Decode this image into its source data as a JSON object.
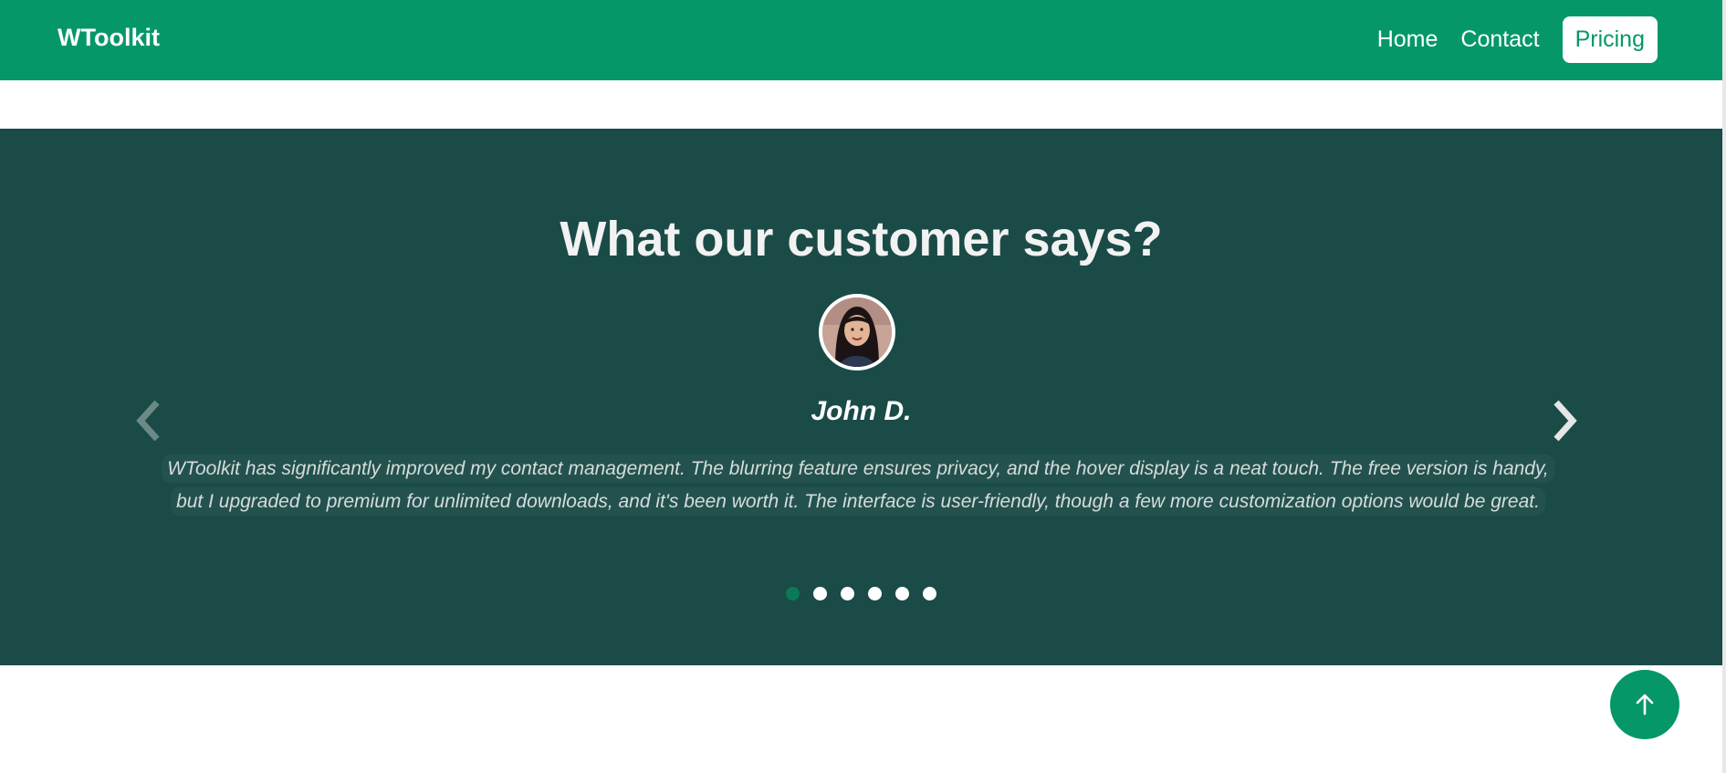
{
  "navbar": {
    "brand": "WToolkit",
    "links": [
      "Home",
      "Contact"
    ],
    "active_link": "Pricing"
  },
  "testimonials": {
    "title": "What our customer says?",
    "current": {
      "name": "John D.",
      "quote": "WToolkit has significantly improved my contact management. The blurring feature ensures privacy, and the hover display is a neat touch. The free version is handy, but I upgraded to premium for unlimited downloads, and it's been worth it. The interface is user-friendly, though a few more customization options would be great."
    },
    "slide_count": 6,
    "active_slide_index": 0,
    "prev_icon": "chevron-left-icon",
    "next_icon": "chevron-right-icon"
  },
  "back_to_top": {
    "icon": "arrow-up-icon"
  },
  "colors": {
    "brand_green": "#05976a",
    "section_bg": "#1a4b47",
    "active_dot": "#0a7a58"
  }
}
